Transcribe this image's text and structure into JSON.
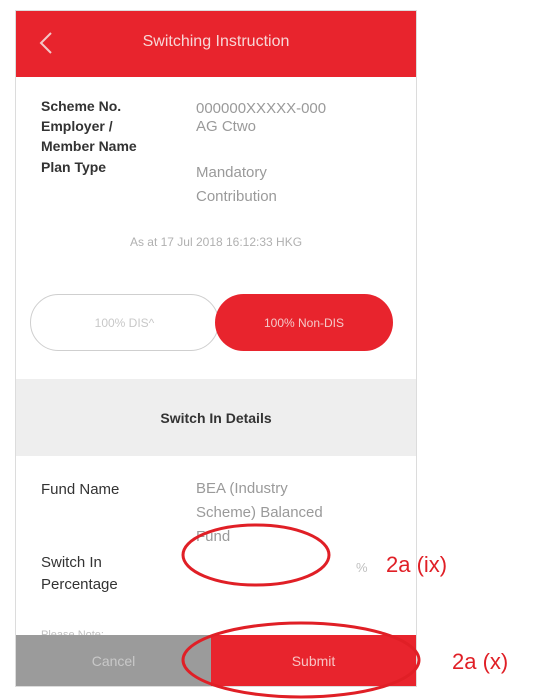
{
  "header": {
    "title": "Switching Instruction",
    "back_icon": "chevron-left-icon"
  },
  "info": {
    "scheme_no_label": "Scheme No.",
    "scheme_no_value": "000000XXXXX-000",
    "employer_label_1": "Employer /",
    "employer_label_2": "Member Name",
    "employer_value": "AG Ctwo",
    "plan_type_label": "Plan Type",
    "plan_type_value_1": "Mandatory",
    "plan_type_value_2": "Contribution",
    "as_at": "As at 17 Jul 2018 16:12:33 HKG"
  },
  "toggle": {
    "dis_label": "100% DIS^",
    "non_dis_label": "100% Non-DIS",
    "selected": "100% Non-DIS"
  },
  "section": {
    "title": "Switch In Details"
  },
  "form": {
    "fund_name_label": "Fund Name",
    "fund_name_value_1": "BEA (Industry",
    "fund_name_value_2": "Scheme) Balanced",
    "fund_name_value_3": "Fund",
    "switch_in_label_1": "Switch In",
    "switch_in_label_2": "Percentage",
    "switch_in_value": "",
    "percent_sign": "%",
    "note": "Please Note:"
  },
  "buttons": {
    "cancel": "Cancel",
    "submit": "Submit"
  },
  "annotations": {
    "ix": "2a (ix)",
    "x": "2a (x)"
  },
  "colors": {
    "brand_red": "#e8242d",
    "annotation_red": "#e01f26",
    "cancel_gray": "#9b9b9b"
  }
}
